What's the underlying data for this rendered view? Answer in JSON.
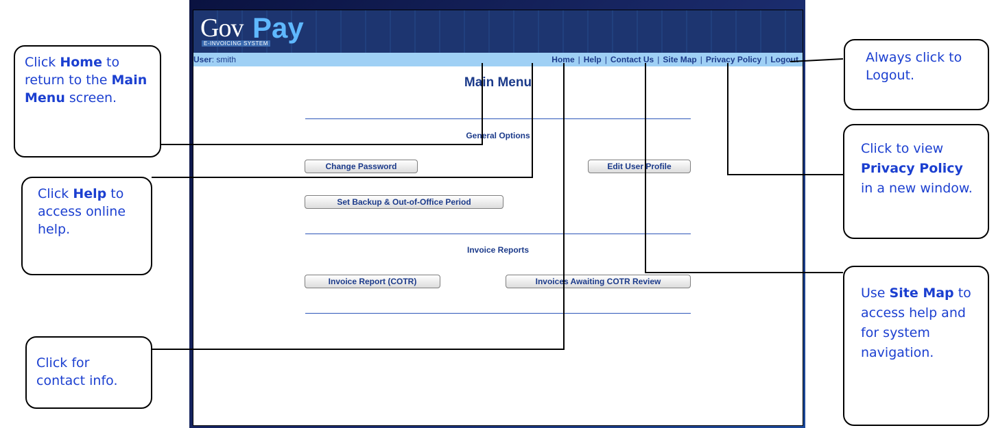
{
  "app": {
    "logo_gov": "Gov",
    "logo_pay": "Pay",
    "logo_subtitle": "E-INVOICING SYSTEM"
  },
  "navbar": {
    "user_prefix": "User",
    "user_name": ": smith",
    "links": [
      "Home",
      "Help",
      "Contact Us",
      "Site Map",
      "Privacy Policy",
      "Logout"
    ]
  },
  "main": {
    "title": "Main Menu",
    "general_options": {
      "heading": "General Options",
      "change_password": "Change Password",
      "edit_user_profile": "Edit User Profile",
      "set_backup": "Set Backup & Out-of-Office Period"
    },
    "invoice_reports": {
      "heading": "Invoice Reports",
      "invoice_report_cotr": "Invoice Report (COTR)",
      "invoices_awaiting": "Invoices Awaiting COTR Review"
    }
  },
  "callouts": {
    "home": {
      "t1": "Click ",
      "b1": "Home",
      "t2": " to return to the ",
      "b2": "Main Menu",
      "t3": " screen."
    },
    "help": {
      "t1": "Click ",
      "b1": "Help",
      "t2": " to access online help."
    },
    "contact": {
      "t1": "Click for contact info."
    },
    "logout": {
      "t1": "Always click to Logout."
    },
    "privacy": {
      "t1": "Click to view ",
      "b1": "Privacy Policy",
      "t2": " in a new window."
    },
    "sitemap": {
      "t1": "Use ",
      "b1": "Site Map",
      "t2": " to access help and for system navigation."
    }
  },
  "colors": {
    "nav_bg": "#9fd0f5",
    "nav_text": "#1b3a8a",
    "callout_text": "#1b3fd0"
  }
}
